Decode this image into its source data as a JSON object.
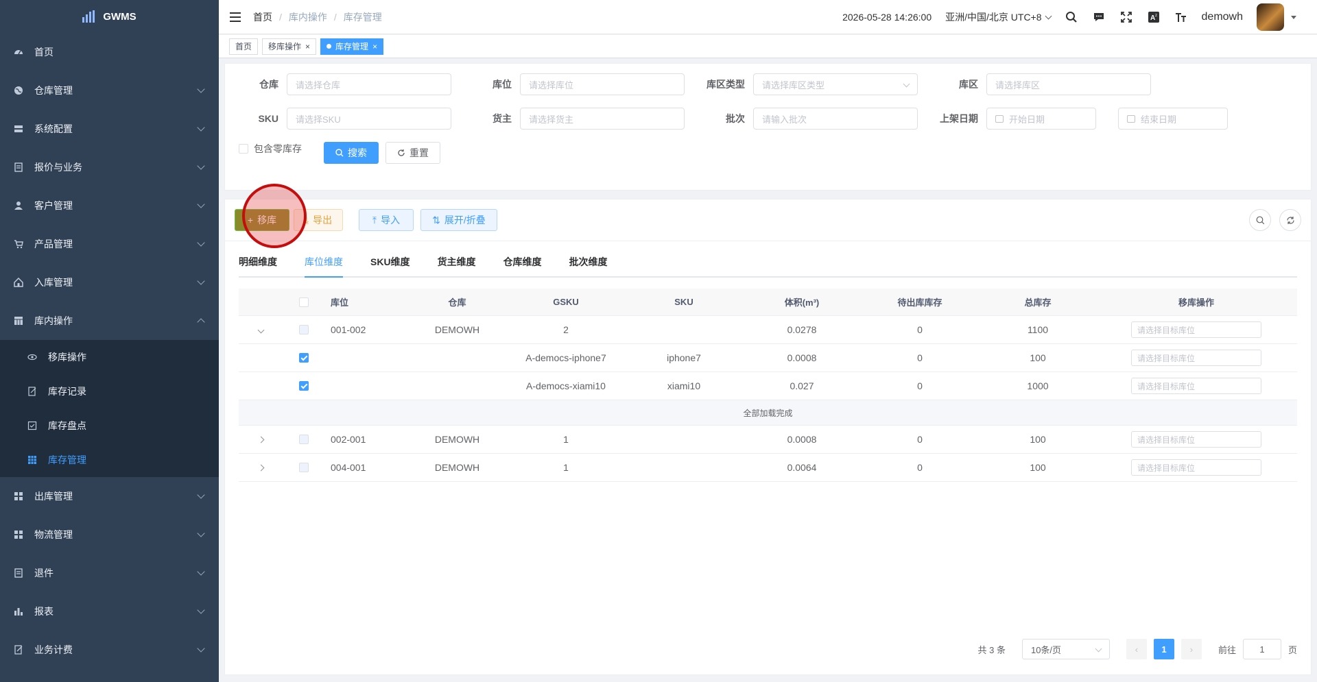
{
  "app": {
    "name": "GWMS"
  },
  "sidebar": {
    "items": [
      {
        "label": "首页",
        "icon": "dashboard-icon"
      },
      {
        "label": "仓库管理",
        "icon": "globe-icon"
      },
      {
        "label": "系统配置",
        "icon": "server-icon"
      },
      {
        "label": "报价与业务",
        "icon": "document-icon"
      },
      {
        "label": "客户管理",
        "icon": "user-icon"
      },
      {
        "label": "产品管理",
        "icon": "cart-icon"
      },
      {
        "label": "入库管理",
        "icon": "home-icon"
      },
      {
        "label": "库内操作",
        "icon": "table-icon"
      }
    ],
    "submenu": [
      {
        "label": "移库操作"
      },
      {
        "label": "库存记录"
      },
      {
        "label": "库存盘点"
      },
      {
        "label": "库存管理"
      }
    ],
    "items_after": [
      {
        "label": "出库管理"
      },
      {
        "label": "物流管理"
      },
      {
        "label": "退件"
      },
      {
        "label": "报表"
      },
      {
        "label": "业务计费"
      }
    ]
  },
  "header": {
    "breadcrumb": [
      "首页",
      "库内操作",
      "库存管理"
    ],
    "datetime": "2026-05-28 14:26:00",
    "timezone": "亚洲/中国/北京 UTC+8",
    "username": "demowh"
  },
  "tags": [
    {
      "label": "首页"
    },
    {
      "label": "移库操作"
    },
    {
      "label": "库存管理"
    }
  ],
  "filters": {
    "warehouse": {
      "label": "仓库",
      "placeholder": "请选择仓库"
    },
    "location": {
      "label": "库位",
      "placeholder": "请选择库位"
    },
    "zone_type": {
      "label": "库区类型",
      "placeholder": "请选择库区类型"
    },
    "zone": {
      "label": "库区",
      "placeholder": "请选择库区"
    },
    "sku": {
      "label": "SKU",
      "placeholder": "请选择SKU"
    },
    "owner": {
      "label": "货主",
      "placeholder": "请选择货主"
    },
    "batch": {
      "label": "批次",
      "placeholder": "请输入批次"
    },
    "shelf_date": {
      "label": "上架日期",
      "start": "开始日期",
      "end": "结束日期"
    },
    "zero_stock": "包含零库存",
    "search": "搜索",
    "reset": "重置"
  },
  "toolbar": {
    "move": "移库",
    "export": "导出",
    "import": "导入",
    "toggle": "展开/折叠"
  },
  "tabs": [
    "明细维度",
    "库位维度",
    "SKU维度",
    "货主维度",
    "仓库维度",
    "批次维度"
  ],
  "table": {
    "columns": [
      "库位",
      "仓库",
      "GSKU",
      "SKU",
      "体积(m³)",
      "待出库库存",
      "总库存",
      "移库操作"
    ],
    "target_placeholder": "请选择目标库位",
    "rows": [
      {
        "location": "001-002",
        "warehouse": "DEMOWH",
        "gsku": "2",
        "sku": "",
        "volume": "0.0278",
        "pending": "0",
        "total": "1100"
      },
      {
        "location": "",
        "warehouse": "",
        "gsku": "A-democs-iphone7",
        "sku": "iphone7",
        "volume": "0.0008",
        "pending": "0",
        "total": "100"
      },
      {
        "location": "",
        "warehouse": "",
        "gsku": "A-democs-xiami10",
        "sku": "xiami10",
        "volume": "0.027",
        "pending": "0",
        "total": "1000"
      },
      {
        "location": "002-001",
        "warehouse": "DEMOWH",
        "gsku": "1",
        "sku": "",
        "volume": "0.0008",
        "pending": "0",
        "total": "100"
      },
      {
        "location": "004-001",
        "warehouse": "DEMOWH",
        "gsku": "1",
        "sku": "",
        "volume": "0.0064",
        "pending": "0",
        "total": "100"
      }
    ],
    "loaded_text": "全部加载完成"
  },
  "pagination": {
    "total": "共 3 条",
    "page_size": "10条/页",
    "current": "1",
    "goto_label": "前往",
    "goto_value": "1",
    "page_suffix": "页"
  },
  "colors": {
    "primary": "#409eff",
    "sidebar": "#304156",
    "success": "#67c23a",
    "warning": "#e6a23c"
  }
}
